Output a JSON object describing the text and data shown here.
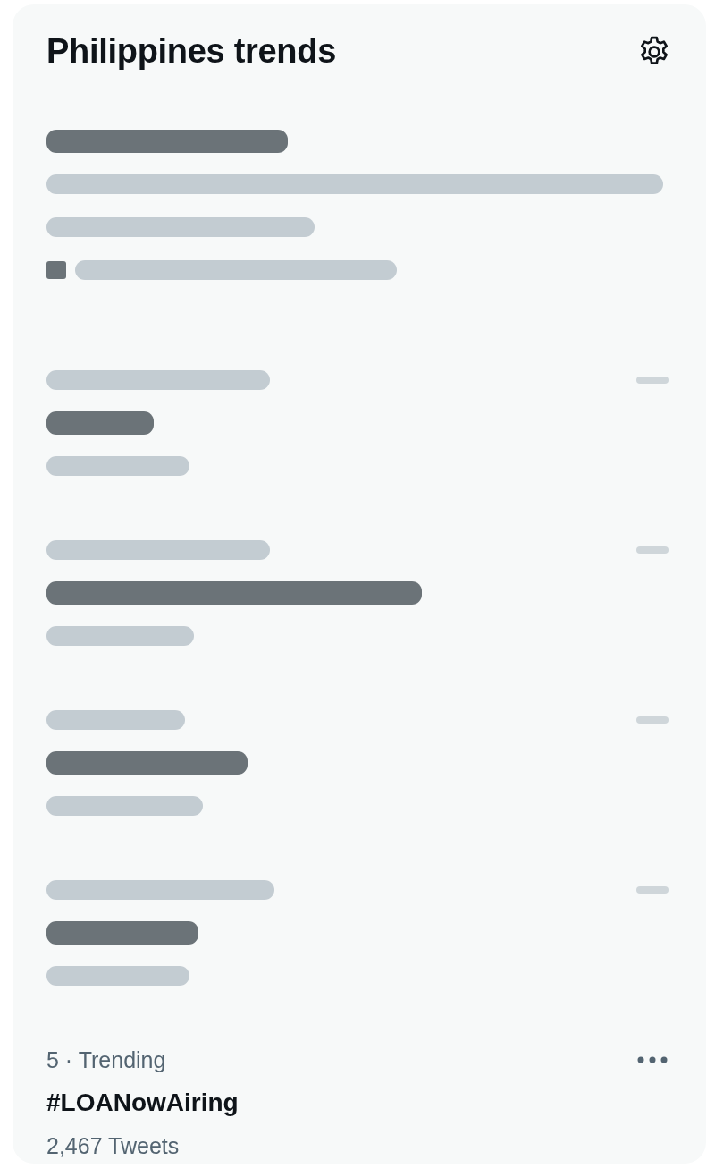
{
  "panel": {
    "title": "Philippines trends"
  },
  "trends": [
    {
      "kind": "promoted_hidden"
    },
    {
      "kind": "trend_hidden"
    },
    {
      "kind": "trend_hidden"
    },
    {
      "kind": "trend_hidden"
    },
    {
      "kind": "trend_hidden"
    },
    {
      "kind": "trend",
      "meta": "5 · Trending",
      "title": "#LOANowAiring",
      "count": "2,467 Tweets"
    }
  ]
}
